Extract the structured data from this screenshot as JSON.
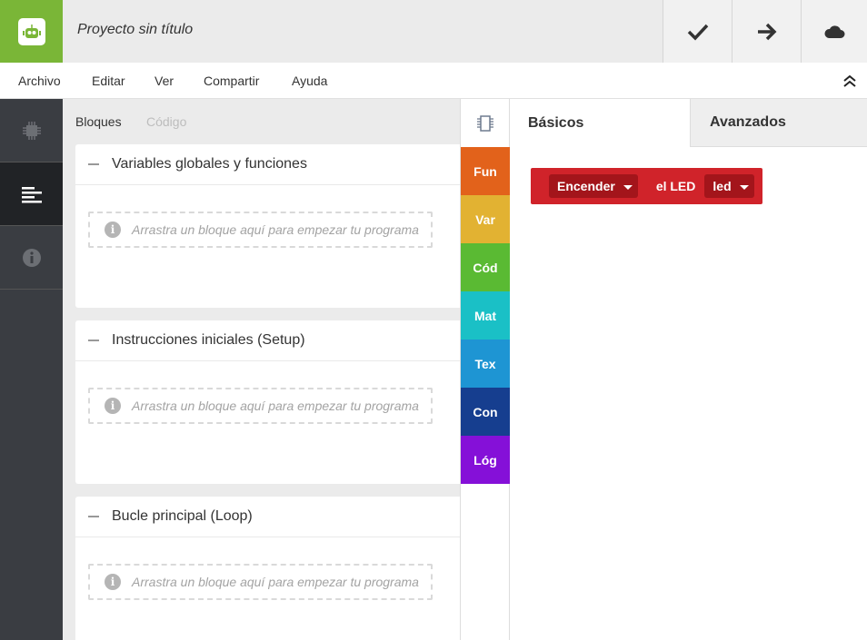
{
  "header": {
    "title": "Proyecto sin título",
    "buttons": [
      "check-icon",
      "arrow-right-icon",
      "cloud-icon"
    ]
  },
  "menu": {
    "items": [
      "Archivo",
      "Editar",
      "Ver",
      "Compartir",
      "Ayuda"
    ]
  },
  "sidebar": {
    "items": [
      {
        "icon": "chip-icon",
        "active": false
      },
      {
        "icon": "align-left-icon",
        "active": true
      },
      {
        "icon": "info-icon",
        "active": false
      }
    ]
  },
  "workspace": {
    "tabs": [
      {
        "label": "Bloques",
        "active": true
      },
      {
        "label": "Código",
        "active": false
      }
    ],
    "sections": [
      {
        "title": "Variables globales y funciones",
        "placeholder": "Arrastra un bloque aquí para empezar tu programa"
      },
      {
        "title": "Instrucciones iniciales (Setup)",
        "placeholder": "Arrastra un bloque aquí para empezar tu programa"
      },
      {
        "title": "Bucle principal (Loop)",
        "placeholder": "Arrastra un bloque aquí para empezar tu programa"
      }
    ]
  },
  "categories": [
    {
      "label": "Fun",
      "color": "#e2621b"
    },
    {
      "label": "Var",
      "color": "#e2b232"
    },
    {
      "label": "Cód",
      "color": "#5aba33"
    },
    {
      "label": "Mat",
      "color": "#1ac0c6"
    },
    {
      "label": "Tex",
      "color": "#1e95d3"
    },
    {
      "label": "Con",
      "color": "#163e8f"
    },
    {
      "label": "Lóg",
      "color": "#8510d8"
    }
  ],
  "panel": {
    "tabs": [
      {
        "label": "Básicos",
        "active": true
      },
      {
        "label": "Avanzados",
        "active": false
      }
    ],
    "block": {
      "action": "Encender",
      "text": "el LED",
      "target": "led",
      "color": "#d0232a"
    }
  },
  "colors": {
    "brand": "#7ab637",
    "sidebar": "#3a3d42",
    "sidebar_active": "#212326"
  }
}
